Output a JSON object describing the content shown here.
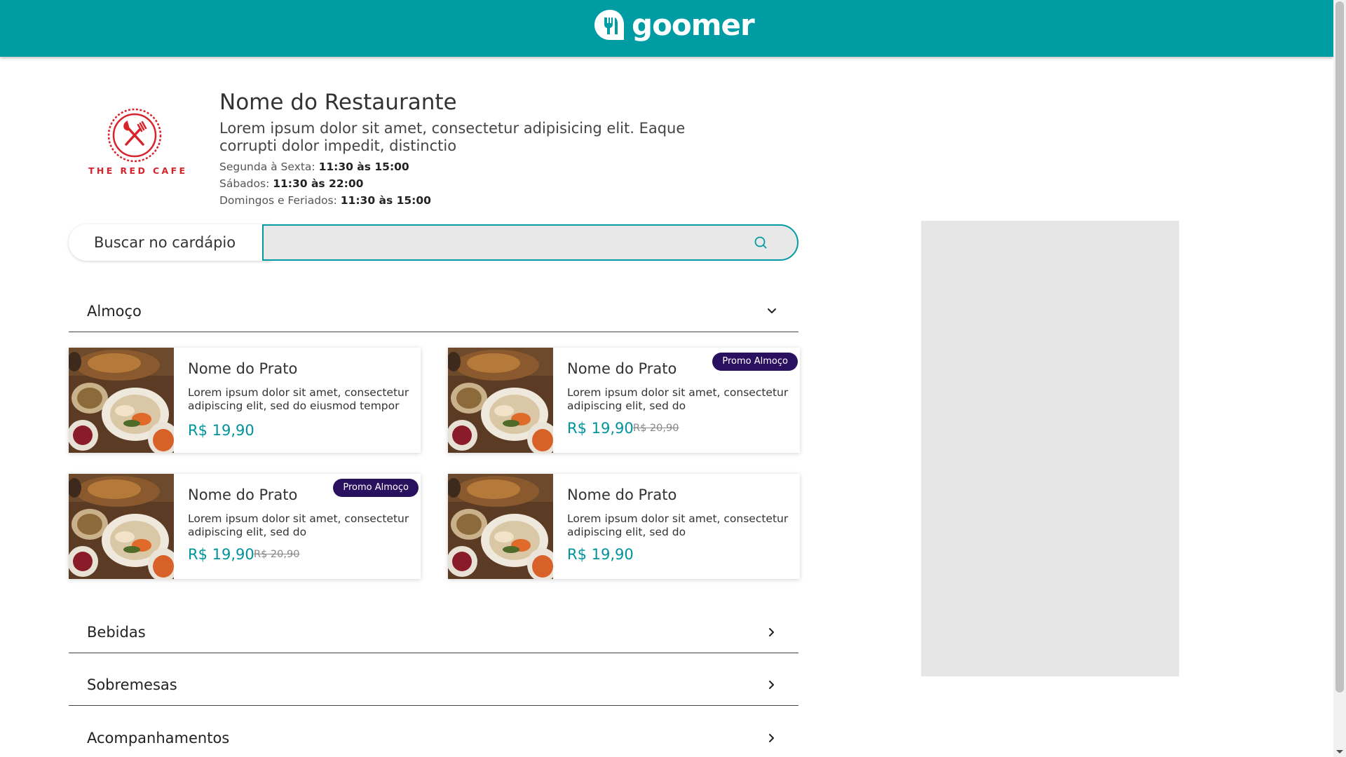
{
  "header": {
    "brand": "goomer",
    "brand_color": "#009ca3"
  },
  "restaurant": {
    "logo_text": "THE RED CAFE",
    "name": "Nome do Restaurante",
    "description": "Lorem ipsum dolor sit amet, consectetur adipisicing elit. Eaque corrupti dolor impedit, distinctio",
    "hours": [
      {
        "label": "Segunda à Sexta: ",
        "time": "11:30 às 15:00"
      },
      {
        "label": "Sábados: ",
        "time": "11:30 às 22:00"
      },
      {
        "label": "Domingos e Feriados: ",
        "time": "11:30 às 15:00"
      }
    ]
  },
  "search": {
    "label": "Buscar no cardápio",
    "value": "",
    "icon": "search-icon"
  },
  "categories": [
    {
      "label": "Almoço",
      "expanded": true,
      "icon": "chevron-down-icon"
    },
    {
      "label": "Bebidas",
      "expanded": false,
      "icon": "chevron-right-icon"
    },
    {
      "label": "Sobremesas",
      "expanded": false,
      "icon": "chevron-right-icon"
    },
    {
      "label": "Acompanhamentos",
      "expanded": false,
      "icon": "chevron-right-icon"
    }
  ],
  "dishes": [
    {
      "title": "Nome do Prato",
      "description": "Lorem ipsum dolor sit amet, consectetur adipiscing elit, sed do eiusmod tempor",
      "price": "R$ 19,90",
      "old_price": "",
      "badge": ""
    },
    {
      "title": "Nome do Prato",
      "description": "Lorem ipsum dolor sit amet, consectetur adipiscing elit, sed do",
      "price": "R$ 19,90",
      "old_price": "R$ 20,90",
      "badge": "Promo Almoço"
    },
    {
      "title": "Nome do Prato",
      "description": "Lorem ipsum dolor sit amet, consectetur adipiscing elit, sed do",
      "price": "R$ 19,90",
      "old_price": "R$ 20,90",
      "badge": "Promo Almoço"
    },
    {
      "title": "Nome do Prato",
      "description": "Lorem ipsum dolor sit amet, consectetur adipiscing elit, sed do",
      "price": "R$ 19,90",
      "old_price": "",
      "badge": ""
    }
  ],
  "colors": {
    "accent": "#009ca3",
    "price": "#00939b",
    "badge": "#2a1160",
    "logo_red": "#d8232a"
  }
}
